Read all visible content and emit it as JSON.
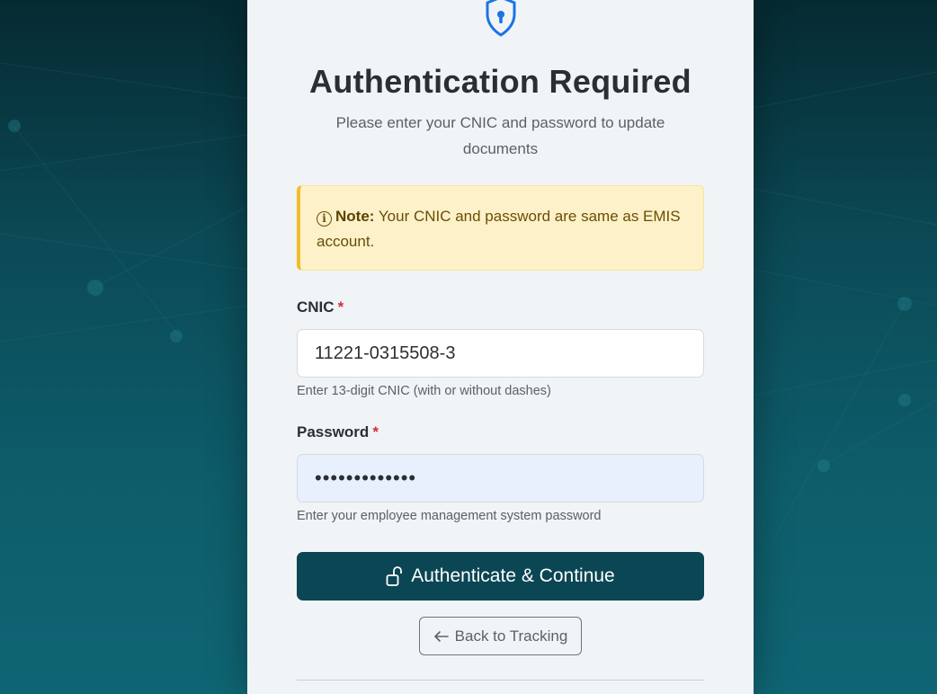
{
  "header": {
    "icon": "shield-keyhole-icon",
    "title": "Authentication Required",
    "subtitle": "Please enter your CNIC and password to update documents"
  },
  "note": {
    "icon": "info-icon",
    "label": "Note:",
    "text": "Your CNIC and password are same as EMIS account."
  },
  "form": {
    "cnic": {
      "label": "CNIC",
      "required_marker": "*",
      "value": "11221-0315508-3",
      "help": "Enter 13-digit CNIC (with or without dashes)"
    },
    "password": {
      "label": "Password",
      "required_marker": "*",
      "value": "•••••••••••••",
      "help": "Enter your employee management system password"
    }
  },
  "actions": {
    "submit_label": "Authenticate & Continue",
    "submit_icon": "unlock-icon",
    "back_label": "Back to Tracking",
    "back_icon": "arrow-left-icon"
  },
  "colors": {
    "primary": "#0b4654",
    "note_bg": "#fdf1c9",
    "note_border": "#f2bd2c",
    "required": "#cf2f3c",
    "shield": "#1a73e8"
  }
}
